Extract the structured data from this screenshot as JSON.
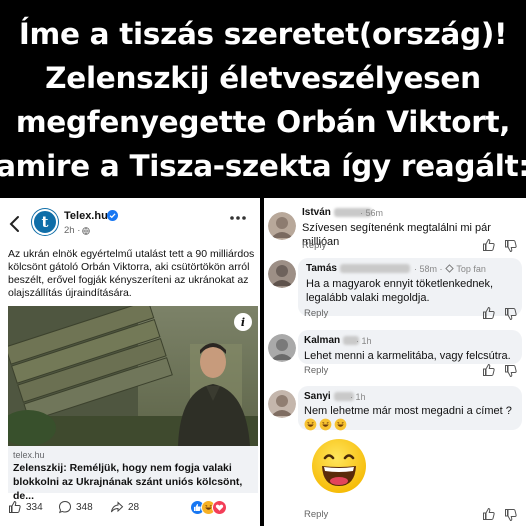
{
  "headline": {
    "line1": "Íme a tiszás szeretet(ország)!",
    "line2": "Zelenszkij életveszélyesen",
    "line3": "megfenyegette Orbán Viktort,",
    "line4": "amire a Tisza-szekta így reagált:"
  },
  "post": {
    "page_name": "Telex.hu",
    "avatar_letter": "t",
    "time": "2h ·",
    "text": "Az ukrán elnök egyértelmű utalást tett a 90 milliárdos kölcsönt gátoló Orbán Viktorra, aki csütörtökön arról beszélt, erővel fogják kényszeríteni az ukránokat az olajszállítás újraindítására.",
    "info_label": "i",
    "link_domain": "telex.hu",
    "link_title": "Zelenszkij: Reméljük, hogy nem fogja valaki blokkolni az Ukrajnának szánt uniós kölcsönt, de...",
    "likes": "334",
    "comments": "348",
    "shares": "28"
  },
  "comments": [
    {
      "name": "István",
      "time": "56m",
      "text": "Szívesen segítenénk megtalálni mi pár millióan",
      "reply": "Reply"
    },
    {
      "name": "Tamás",
      "time": "58m · ",
      "badge": "Top fan",
      "text": "Ha a magyarok ennyit töketlenkednek, legalább valaki megoldja.",
      "reply": "Reply"
    },
    {
      "name": "Kalman",
      "time": "1h",
      "text": "Lehet menni a karmelitába, vagy felcsútra.",
      "reply": "Reply"
    },
    {
      "name": "Sanyi",
      "time": "1h",
      "text": "Nem lehetme már most megadni a címet ?",
      "reply": "Reply"
    }
  ],
  "colors": {
    "facebook_blue": "#1877f2",
    "telex_blue": "#0f6ea8",
    "background": "#000000",
    "bubble": "#f0f2f5"
  }
}
